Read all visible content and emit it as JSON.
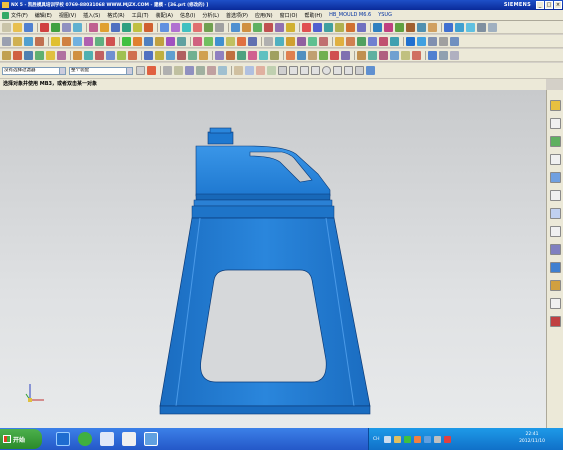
{
  "window": {
    "title": "NX 5 - 凯胜模具培训学校 0769-88031068 WWW.MJZX.COM - 建模 - [36.prt (修改的) ]",
    "brand": "SIEMENS",
    "controls": [
      "_",
      "□",
      "×"
    ]
  },
  "menu": {
    "items": [
      "文件(F)",
      "编辑(E)",
      "视图(V)",
      "插入(S)",
      "格式(R)",
      "工具(T)",
      "装配(A)",
      "信息(I)",
      "分析(L)",
      "首选项(P)",
      "应用(N)",
      "窗口(O)",
      "帮助(H)",
      "HB_MOULD M6.6",
      "YSUG"
    ]
  },
  "toolbar": {
    "filter_select": "没有选择过滤器",
    "assembly_select": "整个装配"
  },
  "cue_line": {
    "text": "选择对象并使用 MB3，或者双击某一对象"
  },
  "taskbar": {
    "start_label": "开始",
    "ime": "CH",
    "time": "22:41",
    "date": "2012/11/10"
  },
  "colors": {
    "model_blue": "#1e78d0",
    "titlebar": "#1e50c8",
    "taskbar": "#2f6ee0"
  }
}
